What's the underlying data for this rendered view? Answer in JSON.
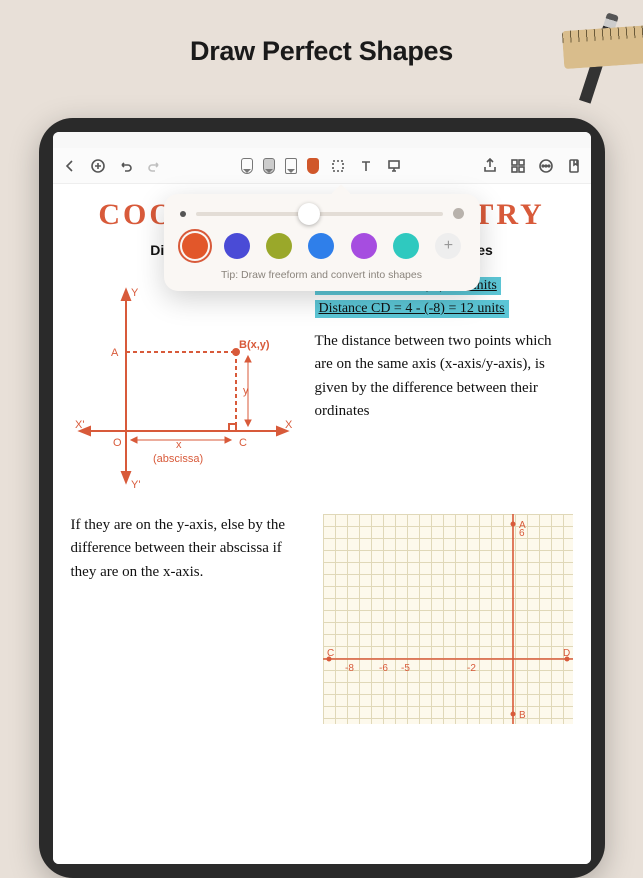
{
  "promo": {
    "title": "Draw Perfect Shapes"
  },
  "toolbar": {
    "back": "‹",
    "new": "+",
    "undo": "↶",
    "redo": "↷"
  },
  "popover": {
    "tip": "Tip: Draw freeform and convert into shapes",
    "swatches": [
      "#e2572a",
      "#4a4bd6",
      "#9aa82a",
      "#2f7fea",
      "#a64de0",
      "#2fc9bf"
    ]
  },
  "doc": {
    "title_left": "COO",
    "title_right": "TRY",
    "subtitle_left": "Distance B",
    "subtitle_right": "dinate Axes",
    "hl1": "Distance  AB = 6 - (-2) = 8 units",
    "hl2": "Distance  CD = 4 - (-8) = 12 units",
    "para1": "The distance between two points which are on the same axis (x-axis/y-axis), is given by the difference between their  ordinates",
    "para2": "If they are on the y-axis, else by the difference  between their abscissa if they are on the x-axis.",
    "diagram": {
      "Y": "Y",
      "Yp": "Y'",
      "X": "X",
      "Xp": "X'",
      "O": "O",
      "A": "A",
      "B": "B(x,y)",
      "C": "C",
      "x": "x",
      "y": "y",
      "abscissa": "(abscissa)"
    },
    "graph": {
      "A": "A",
      "B": "B",
      "C": "C",
      "D": "D",
      "ticks_top": "6",
      "ticks_x": [
        "-8",
        "-6",
        "-5",
        "-2"
      ]
    }
  }
}
